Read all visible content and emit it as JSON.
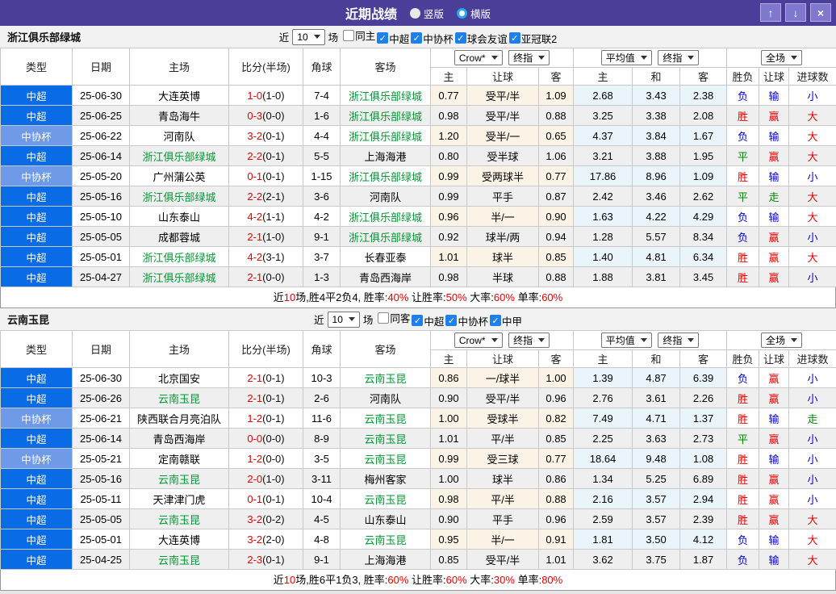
{
  "colors": {
    "titlebar": "#4A3E99",
    "titlebtn": "#8078CC",
    "titlebtn-border": "#B3ACE4",
    "primary-type": "#0A6BE6",
    "secondary-type": "#6F9AE8",
    "tracked": "#009933",
    "red": "#E60000",
    "blue": "#0000D0",
    "green": "#008800",
    "ah-bg": "#FBF3E6",
    "eu-bg": "#E9F5FB",
    "stripe": "#EFEFEF",
    "filter-bg": "#F2F2F2",
    "check-blue": "#1E80E8"
  },
  "title_bar": {
    "title": "近期战绩",
    "vertical_label": "竖版",
    "horizontal_label": "横版",
    "up_icon": "↑",
    "down_icon": "↓",
    "close_icon": "×"
  },
  "table_header": {
    "main": [
      "类型",
      "日期",
      "主场",
      "比分(半场)",
      "角球",
      "客场"
    ],
    "ah_company": "Crow*",
    "ah_stage": "终指",
    "eu_company": "平均值",
    "eu_stage": "终指",
    "scope": "全场",
    "sub": [
      "主",
      "让球",
      "客",
      "主",
      "和",
      "客",
      "胜负",
      "让球",
      "进球数"
    ]
  },
  "type_styles": {
    "中超": "primary",
    "中协杯": "secondary",
    "中甲": "primary"
  },
  "result_colors": {
    "胜": "r",
    "平": "g",
    "负": "b",
    "赢": "r",
    "走": "g",
    "输": "b",
    "大": "r",
    "小": "b"
  },
  "sections": [
    {
      "team": "浙江俱乐部绿城",
      "filter": {
        "prefix": "近",
        "count": "10",
        "suffix": "场",
        "options": [
          {
            "label": "同主",
            "checked": false
          },
          {
            "label": "中超",
            "checked": true
          },
          {
            "label": "中协杯",
            "checked": true
          },
          {
            "label": "球会友谊",
            "checked": true
          },
          {
            "label": "亚冠联2",
            "checked": true
          }
        ]
      },
      "rows": [
        {
          "type": "中超",
          "date": "25-06-30",
          "home": "大连英博",
          "score": "1-0",
          "half": "(1-0)",
          "corner": "7-4",
          "away": "浙江俱乐部绿城",
          "ah": [
            "0.77",
            "受平/半",
            "1.09"
          ],
          "eu": [
            "2.68",
            "3.43",
            "2.38"
          ],
          "res": [
            "负",
            "输",
            "小"
          ]
        },
        {
          "type": "中超",
          "date": "25-06-25",
          "home": "青岛海牛",
          "score": "0-3",
          "half": "(0-0)",
          "corner": "1-6",
          "away": "浙江俱乐部绿城",
          "ah": [
            "0.98",
            "受平/半",
            "0.88"
          ],
          "eu": [
            "3.25",
            "3.38",
            "2.08"
          ],
          "res": [
            "胜",
            "赢",
            "大"
          ]
        },
        {
          "type": "中协杯",
          "date": "25-06-22",
          "home": "河南队",
          "score": "3-2",
          "half": "(0-1)",
          "corner": "4-4",
          "away": "浙江俱乐部绿城",
          "ah": [
            "1.20",
            "受半/一",
            "0.65"
          ],
          "eu": [
            "4.37",
            "3.84",
            "1.67"
          ],
          "res": [
            "负",
            "输",
            "大"
          ]
        },
        {
          "type": "中超",
          "date": "25-06-14",
          "home": "浙江俱乐部绿城",
          "score": "2-2",
          "half": "(0-1)",
          "corner": "5-5",
          "away": "上海海港",
          "ah": [
            "0.80",
            "受半球",
            "1.06"
          ],
          "eu": [
            "3.21",
            "3.88",
            "1.95"
          ],
          "res": [
            "平",
            "赢",
            "大"
          ]
        },
        {
          "type": "中协杯",
          "date": "25-05-20",
          "home": "广州蒲公英",
          "score": "0-1",
          "half": "(0-1)",
          "corner": "1-15",
          "away": "浙江俱乐部绿城",
          "ah": [
            "0.99",
            "受两球半",
            "0.77"
          ],
          "eu": [
            "17.86",
            "8.96",
            "1.09"
          ],
          "res": [
            "胜",
            "输",
            "小"
          ]
        },
        {
          "type": "中超",
          "date": "25-05-16",
          "home": "浙江俱乐部绿城",
          "score": "2-2",
          "half": "(2-1)",
          "corner": "3-6",
          "away": "河南队",
          "ah": [
            "0.99",
            "平手",
            "0.87"
          ],
          "eu": [
            "2.42",
            "3.46",
            "2.62"
          ],
          "res": [
            "平",
            "走",
            "大"
          ]
        },
        {
          "type": "中超",
          "date": "25-05-10",
          "home": "山东泰山",
          "score": "4-2",
          "half": "(1-1)",
          "corner": "4-2",
          "away": "浙江俱乐部绿城",
          "ah": [
            "0.96",
            "半/一",
            "0.90"
          ],
          "eu": [
            "1.63",
            "4.22",
            "4.29"
          ],
          "res": [
            "负",
            "输",
            "大"
          ]
        },
        {
          "type": "中超",
          "date": "25-05-05",
          "home": "成都蓉城",
          "score": "2-1",
          "half": "(1-0)",
          "corner": "9-1",
          "away": "浙江俱乐部绿城",
          "ah": [
            "0.92",
            "球半/两",
            "0.94"
          ],
          "eu": [
            "1.28",
            "5.57",
            "8.34"
          ],
          "res": [
            "负",
            "赢",
            "小"
          ]
        },
        {
          "type": "中超",
          "date": "25-05-01",
          "home": "浙江俱乐部绿城",
          "score": "4-2",
          "half": "(3-1)",
          "corner": "3-7",
          "away": "长春亚泰",
          "ah": [
            "1.01",
            "球半",
            "0.85"
          ],
          "eu": [
            "1.40",
            "4.81",
            "6.34"
          ],
          "res": [
            "胜",
            "赢",
            "大"
          ]
        },
        {
          "type": "中超",
          "date": "25-04-27",
          "home": "浙江俱乐部绿城",
          "score": "2-1",
          "half": "(0-0)",
          "corner": "1-3",
          "away": "青岛西海岸",
          "ah": [
            "0.98",
            "半球",
            "0.88"
          ],
          "eu": [
            "1.88",
            "3.81",
            "3.45"
          ],
          "res": [
            "胜",
            "赢",
            "小"
          ]
        }
      ],
      "summary": [
        {
          "t": "近"
        },
        {
          "t": "10",
          "red": true
        },
        {
          "t": "场,胜4平2负4, 胜率:"
        },
        {
          "t": "40%",
          "red": true
        },
        {
          "t": " 让胜率:"
        },
        {
          "t": "50%",
          "red": true
        },
        {
          "t": " 大率:"
        },
        {
          "t": "60%",
          "red": true
        },
        {
          "t": " 单率:"
        },
        {
          "t": "60%",
          "red": true
        }
      ]
    },
    {
      "team": "云南玉昆",
      "filter": {
        "prefix": "近",
        "count": "10",
        "suffix": "场",
        "options": [
          {
            "label": "同客",
            "checked": false
          },
          {
            "label": "中超",
            "checked": true
          },
          {
            "label": "中协杯",
            "checked": true
          },
          {
            "label": "中甲",
            "checked": true
          }
        ]
      },
      "rows": [
        {
          "type": "中超",
          "date": "25-06-30",
          "home": "北京国安",
          "score": "2-1",
          "half": "(0-1)",
          "corner": "10-3",
          "away": "云南玉昆",
          "ah": [
            "0.86",
            "一/球半",
            "1.00"
          ],
          "eu": [
            "1.39",
            "4.87",
            "6.39"
          ],
          "res": [
            "负",
            "赢",
            "小"
          ]
        },
        {
          "type": "中超",
          "date": "25-06-26",
          "home": "云南玉昆",
          "score": "2-1",
          "half": "(0-1)",
          "corner": "2-6",
          "away": "河南队",
          "ah": [
            "0.90",
            "受平/半",
            "0.96"
          ],
          "eu": [
            "2.76",
            "3.61",
            "2.26"
          ],
          "res": [
            "胜",
            "赢",
            "小"
          ]
        },
        {
          "type": "中协杯",
          "date": "25-06-21",
          "home": "陕西联合月亮泊队",
          "score": "1-2",
          "half": "(0-1)",
          "corner": "11-6",
          "away": "云南玉昆",
          "ah": [
            "1.00",
            "受球半",
            "0.82"
          ],
          "eu": [
            "7.49",
            "4.71",
            "1.37"
          ],
          "res": [
            "胜",
            "输",
            "走"
          ]
        },
        {
          "type": "中超",
          "date": "25-06-14",
          "home": "青岛西海岸",
          "score": "0-0",
          "half": "(0-0)",
          "corner": "8-9",
          "away": "云南玉昆",
          "ah": [
            "1.01",
            "平/半",
            "0.85"
          ],
          "eu": [
            "2.25",
            "3.63",
            "2.73"
          ],
          "res": [
            "平",
            "赢",
            "小"
          ]
        },
        {
          "type": "中协杯",
          "date": "25-05-21",
          "home": "定南赣联",
          "score": "1-2",
          "half": "(0-0)",
          "corner": "3-5",
          "away": "云南玉昆",
          "ah": [
            "0.99",
            "受三球",
            "0.77"
          ],
          "eu": [
            "18.64",
            "9.48",
            "1.08"
          ],
          "res": [
            "胜",
            "输",
            "小"
          ]
        },
        {
          "type": "中超",
          "date": "25-05-16",
          "home": "云南玉昆",
          "score": "2-0",
          "half": "(1-0)",
          "corner": "3-11",
          "away": "梅州客家",
          "ah": [
            "1.00",
            "球半",
            "0.86"
          ],
          "eu": [
            "1.34",
            "5.25",
            "6.89"
          ],
          "res": [
            "胜",
            "赢",
            "小"
          ]
        },
        {
          "type": "中超",
          "date": "25-05-11",
          "home": "天津津门虎",
          "score": "0-1",
          "half": "(0-1)",
          "corner": "10-4",
          "away": "云南玉昆",
          "ah": [
            "0.98",
            "平/半",
            "0.88"
          ],
          "eu": [
            "2.16",
            "3.57",
            "2.94"
          ],
          "res": [
            "胜",
            "赢",
            "小"
          ]
        },
        {
          "type": "中超",
          "date": "25-05-05",
          "home": "云南玉昆",
          "score": "3-2",
          "half": "(0-2)",
          "corner": "4-5",
          "away": "山东泰山",
          "ah": [
            "0.90",
            "平手",
            "0.96"
          ],
          "eu": [
            "2.59",
            "3.57",
            "2.39"
          ],
          "res": [
            "胜",
            "赢",
            "大"
          ]
        },
        {
          "type": "中超",
          "date": "25-05-01",
          "home": "大连英博",
          "score": "3-2",
          "half": "(2-0)",
          "corner": "4-8",
          "away": "云南玉昆",
          "ah": [
            "0.95",
            "半/一",
            "0.91"
          ],
          "eu": [
            "1.81",
            "3.50",
            "4.12"
          ],
          "res": [
            "负",
            "输",
            "大"
          ]
        },
        {
          "type": "中超",
          "date": "25-04-25",
          "home": "云南玉昆",
          "score": "2-3",
          "half": "(0-1)",
          "corner": "9-1",
          "away": "上海海港",
          "ah": [
            "0.85",
            "受平/半",
            "1.01"
          ],
          "eu": [
            "3.62",
            "3.75",
            "1.87"
          ],
          "res": [
            "负",
            "输",
            "大"
          ]
        }
      ],
      "summary": [
        {
          "t": "近"
        },
        {
          "t": "10",
          "red": true
        },
        {
          "t": "场,胜6平1负3, 胜率:"
        },
        {
          "t": "60%",
          "red": true
        },
        {
          "t": " 让胜率:"
        },
        {
          "t": "60%",
          "red": true
        },
        {
          "t": " 大率:"
        },
        {
          "t": "30%",
          "red": true
        },
        {
          "t": " 单率:"
        },
        {
          "t": "80%",
          "red": true
        }
      ]
    }
  ]
}
